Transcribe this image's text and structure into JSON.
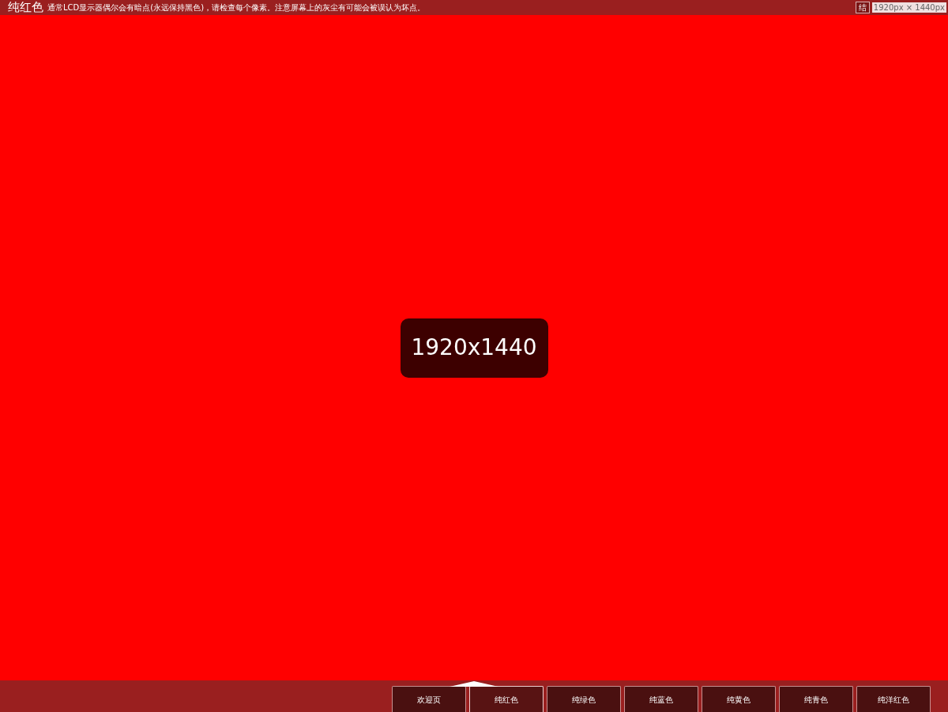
{
  "header": {
    "title": "纯红色",
    "description": "通常LCD显示器偶尔会有暗点(永远保持黑色)，请检查每个像素。注意屏幕上的灰尘有可能会被误认为坏点。",
    "button": "结",
    "size_overlay": "1920px × 1440px"
  },
  "resolution_badge": "1920x1440",
  "tabs": [
    {
      "label": "欢迎页",
      "selected": false
    },
    {
      "label": "纯红色",
      "selected": true
    },
    {
      "label": "纯绿色",
      "selected": false
    },
    {
      "label": "纯蓝色",
      "selected": false
    },
    {
      "label": "纯黄色",
      "selected": false
    },
    {
      "label": "纯青色",
      "selected": false
    },
    {
      "label": "纯洋红色",
      "selected": false
    }
  ]
}
